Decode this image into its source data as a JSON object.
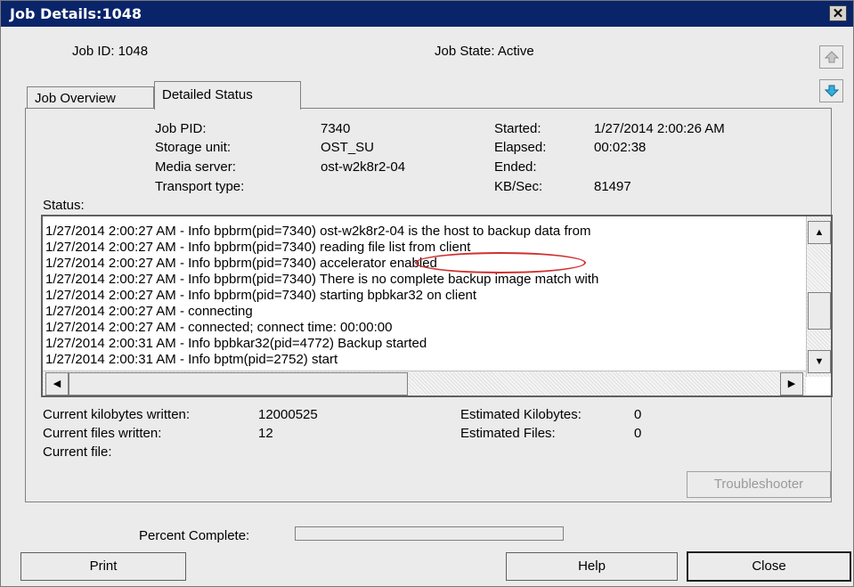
{
  "window": {
    "title": "Job Details:1048",
    "close_glyph": "✕"
  },
  "header": {
    "job_id_label": "Job ID: 1048",
    "job_state_label": "Job State: Active"
  },
  "tabs": [
    {
      "label": "Job Overview",
      "selected": false
    },
    {
      "label": "Detailed Status",
      "selected": true
    }
  ],
  "details": {
    "job_pid_label": "Job PID:",
    "job_pid_value": "7340",
    "storage_unit_label": "Storage unit:",
    "storage_unit_value": "OST_SU",
    "media_server_label": "Media server:",
    "media_server_value": "ost-w2k8r2-04",
    "transport_type_label": "Transport type:",
    "started_label": "Started:",
    "started_value": "1/27/2014 2:00:26 AM",
    "elapsed_label": "Elapsed:",
    "elapsed_value": "00:02:38",
    "ended_label": "Ended:",
    "kbsec_label": "KB/Sec:",
    "kbsec_value": "81497"
  },
  "status": {
    "label": "Status:",
    "lines": [
      "1/27/2014 2:00:27 AM - Info bpbrm(pid=7340) ost-w2k8r2-04 is the host to backup data from",
      "1/27/2014 2:00:27 AM - Info bpbrm(pid=7340) reading file list from client",
      "1/27/2014 2:00:27 AM - Info bpbrm(pid=7340) accelerator enabled",
      "1/27/2014 2:00:27 AM - Info bpbrm(pid=7340) There is no complete backup image match with",
      "1/27/2014 2:00:27 AM - Info bpbrm(pid=7340) starting bpbkar32 on client",
      "1/27/2014 2:00:27 AM - connecting",
      "1/27/2014 2:00:27 AM - connected; connect time: 00:00:00",
      "1/27/2014 2:00:31 AM - Info bpbkar32(pid=4772) Backup started",
      "1/27/2014 2:00:31 AM - Info bptm(pid=2752) start"
    ],
    "highlight_color": "#d03030"
  },
  "progress_info": {
    "current_kb_label": "Current kilobytes written:",
    "current_kb_value": "12000525",
    "current_files_label": "Current files written:",
    "current_files_value": "12",
    "current_file_label": "Current file:",
    "estimated_kb_label": "Estimated Kilobytes:",
    "estimated_kb_value": "0",
    "estimated_files_label": "Estimated Files:",
    "estimated_files_value": "0"
  },
  "buttons": {
    "troubleshooter": "Troubleshooter",
    "print": "Print",
    "help": "Help",
    "close": "Close"
  },
  "percent": {
    "label": "Percent Complete:",
    "value_fraction": 0
  },
  "icons": {
    "up": "up-arrow-icon",
    "down": "down-arrow-icon",
    "scroll_up": "scroll-up-icon",
    "scroll_down": "scroll-down-icon",
    "scroll_left": "scroll-left-icon",
    "scroll_right": "scroll-right-icon"
  },
  "colors": {
    "titlebar": "#0a246a",
    "down_arrow": "#2fb0e0"
  }
}
